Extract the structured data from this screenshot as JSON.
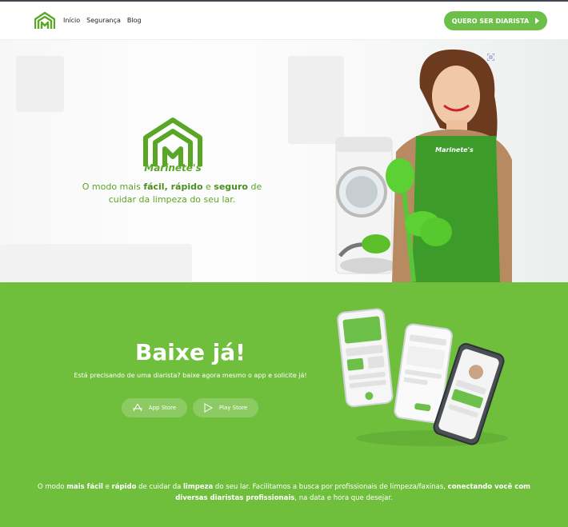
{
  "header": {
    "nav": [
      "Início",
      "Segurança",
      "Blog"
    ],
    "cta_label": "QUERO SER DIARISTA"
  },
  "hero": {
    "brand_name": "Marinete's",
    "tagline": {
      "t1": "O modo mais ",
      "b1": "fácil, rápido",
      "t2": " e ",
      "b2": "seguro",
      "t3": " de cuidar da limpeza do seu lar."
    },
    "apron_text": "Marinete's"
  },
  "app_section": {
    "title": "Baixe já!",
    "subtitle": "Está precisando de uma diarista? baixe agora mesmo o app e solicite já!",
    "app_store_label": "App Store",
    "play_store_label": "Play Store"
  },
  "footer_text": {
    "t1": "O modo ",
    "b1": "mais fácil",
    "t2": " e ",
    "b2": "rápido",
    "t3": " de cuidar da ",
    "b3": "limpeza",
    "t4": " do seu lar. Facilitamos a busca por profissionais de limpeza/faxinas, ",
    "b4": "conectando você com diversas diaristas profissionais",
    "t5": ", na data e hora que desejar."
  },
  "colors": {
    "brand_green": "#6cc04a",
    "section_green": "#70bf3c",
    "dark_green": "#4a8e1f"
  },
  "icons": [
    "house-logo-icon",
    "chevron-right-icon",
    "expand-icon",
    "app-store-icon",
    "play-store-icon"
  ]
}
